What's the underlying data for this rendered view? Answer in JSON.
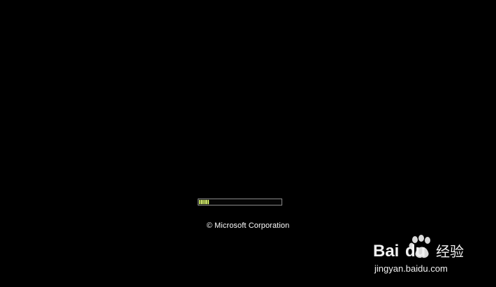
{
  "boot": {
    "progress_fraction": 0.1,
    "copyright": "© Microsoft Corporation"
  },
  "watermark": {
    "brand": "Bai经验",
    "url": "jingyan.baidu.com"
  },
  "colors": {
    "background": "#000000",
    "progress_fill": "#c4e05a",
    "progress_border": "#8a8a8a",
    "text": "#ffffff"
  }
}
